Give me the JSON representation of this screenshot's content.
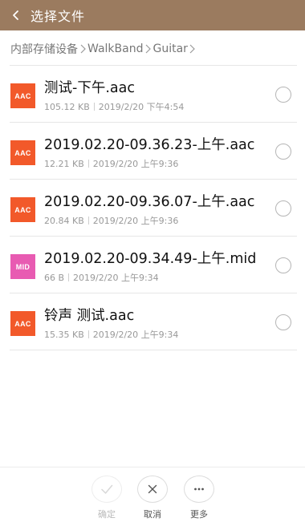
{
  "header": {
    "title": "选择文件",
    "back_icon": "chevron-left-icon",
    "background_color": "#9b7b5f"
  },
  "breadcrumb": {
    "items": [
      "内部存储设备",
      "WalkBand",
      "Guitar"
    ],
    "separator_icon": "chevron-right-icon"
  },
  "files": [
    {
      "icon_label": "AAC",
      "icon_color": "#f2592a",
      "name": "测试-下午.aac",
      "size": "105.12 KB",
      "date": "2019/2/20 下午4:54",
      "selected": false
    },
    {
      "icon_label": "AAC",
      "icon_color": "#f2592a",
      "name": "2019.02.20-09.36.23-上午.aac",
      "size": "12.21 KB",
      "date": "2019/2/20 上午9:36",
      "selected": false
    },
    {
      "icon_label": "AAC",
      "icon_color": "#f2592a",
      "name": "2019.02.20-09.36.07-上午.aac",
      "size": "20.84 KB",
      "date": "2019/2/20 上午9:36",
      "selected": false
    },
    {
      "icon_label": "MID",
      "icon_color": "#e85bb2",
      "name": "2019.02.20-09.34.49-上午.mid",
      "size": "66 B",
      "date": "2019/2/20 上午9:34",
      "selected": false
    },
    {
      "icon_label": "AAC",
      "icon_color": "#f2592a",
      "name": "铃声 测试.aac",
      "size": "15.35 KB",
      "date": "2019/2/20 上午9:34",
      "selected": false
    }
  ],
  "bottom_bar": {
    "confirm": {
      "label": "确定",
      "icon": "check-icon",
      "disabled": true
    },
    "cancel": {
      "label": "取消",
      "icon": "close-icon"
    },
    "more": {
      "label": "更多",
      "icon": "more-dots-icon"
    }
  }
}
